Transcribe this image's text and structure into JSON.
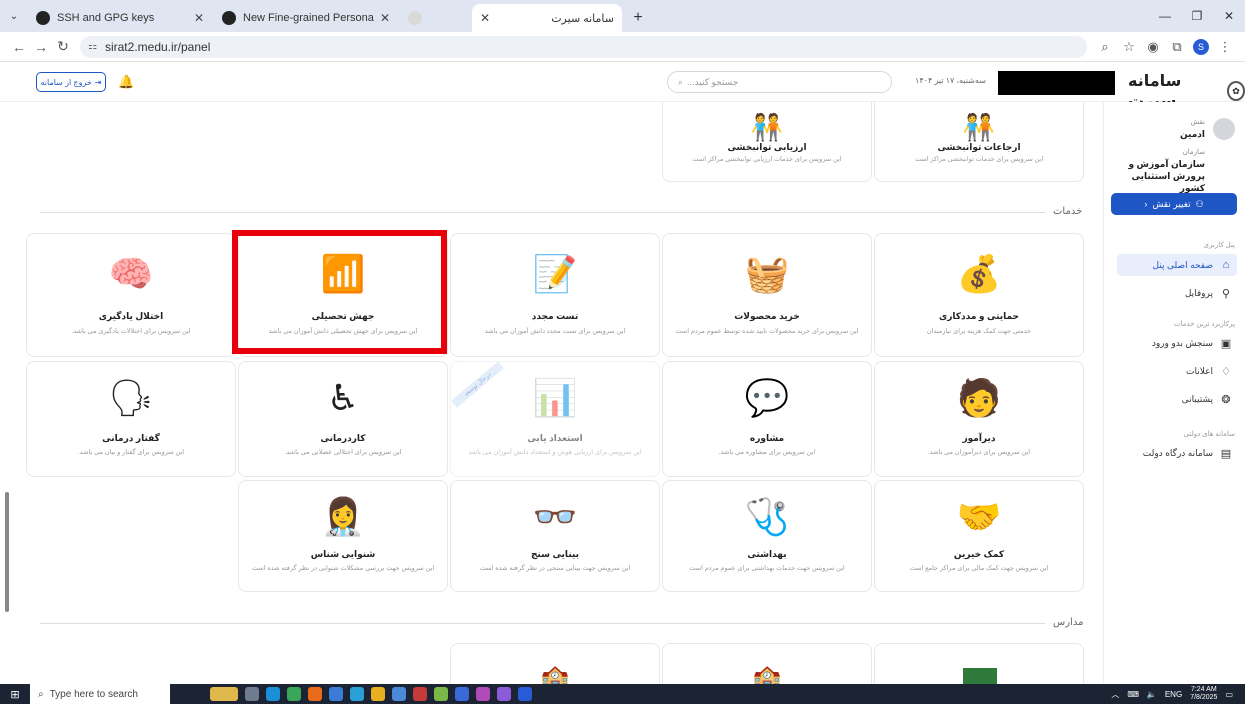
{
  "browser": {
    "tabs": [
      {
        "title": "SSH and GPG keys",
        "active": false
      },
      {
        "title": "New Fine-grained Personal Acc",
        "active": false
      },
      {
        "title": "",
        "active": false
      },
      {
        "title": "سامانه سیرت",
        "active": true
      }
    ],
    "new_tab": "+",
    "url_site_icon": "⚏",
    "url": "sirat2.medu.ir/panel",
    "profile_initial": "S"
  },
  "header": {
    "logout_label": "خروج از سامانه",
    "search_placeholder": "جستجو کنید...",
    "date": "سه‌شنبه، ۱۷ تیر ۱۴۰۴",
    "brand": "سامانه سیرت"
  },
  "sidebar": {
    "role_label": "نقش",
    "role_value": "ادمین",
    "org_label": "سازمان",
    "org_value": "سازمان آموزش و پرورش استثنایی کشور",
    "change_role": "تغییر نقش",
    "panel_section": "پنل کاربری",
    "items_main": [
      {
        "label": "صفحه اصلی پنل",
        "icon": "home-icon",
        "active": true
      },
      {
        "label": "پروفایل",
        "icon": "user-icon",
        "active": false
      }
    ],
    "services_section": "پرکاربرد ترین خدمات",
    "items_services": [
      {
        "label": "سنجش بدو ورود",
        "icon": "clipboard-icon"
      },
      {
        "label": "اعلانات",
        "icon": "bell-icon"
      },
      {
        "label": "پشتیبانی",
        "icon": "support-icon"
      }
    ],
    "gov_section": "سامانه های دولتی",
    "items_gov": [
      {
        "label": "سامانه درگاه دولت",
        "icon": "gov-icon"
      }
    ]
  },
  "top_cards": [
    {
      "title": "ارجاعات توانبخشی",
      "desc": "این سرویس برای خدمات توانبخشی مراکز است"
    },
    {
      "title": "ارزیابی توانبخشی",
      "desc": "این سرویس برای خدمات ارزیابی توانبخشی مراکز است"
    }
  ],
  "services_label": "خدمات",
  "schools_label": "مدارس",
  "services": [
    {
      "title": "حمایتی و مددکاری",
      "desc": "خدمتی جهت کمک هزینه برای نیازمندان",
      "icon": "support-money-icon",
      "glyph": "💰"
    },
    {
      "title": "خرید محصولات",
      "desc": "این سرویس برای خرید محصولات تایید شده توسط عموم مردم است",
      "icon": "shopping-basket-icon",
      "glyph": "🧺"
    },
    {
      "title": "تست مجدد",
      "desc": "این سرویس برای تست مجدد دانش آموزان می باشد",
      "icon": "test-form-icon",
      "glyph": "📝"
    },
    {
      "title": "جهش تحصیلی",
      "desc": "این سرویس برای جهش تحصیلی دانش آموزان می باشد",
      "icon": "stairs-growth-icon",
      "glyph": "📶"
    },
    {
      "title": "اختلال یادگیری",
      "desc": "این سرویس برای اختلالات یادگیری می باشد.",
      "icon": "brain-icon",
      "glyph": "🧠"
    },
    {
      "title": "دیرآموز",
      "desc": "این سرویس برای دیرآموزان می باشد.",
      "icon": "student-icon",
      "glyph": "🧑"
    },
    {
      "title": "مشاوره",
      "desc": "این سرویس برای مشاوره می باشد.",
      "icon": "counseling-icon",
      "glyph": "💬"
    },
    {
      "title": "استعداد یابی",
      "desc": "این سرویس برای ارزیابی هوش و استعداد دانش آموزان می باشد",
      "icon": "gauge-icon",
      "glyph": "📊",
      "ribbon": "درحال توسعه",
      "disabled": true
    },
    {
      "title": "کاردرمانی",
      "desc": "این سرویس برای اختلالی عضلانی می باشد.",
      "icon": "occupational-therapy-icon",
      "glyph": "♿"
    },
    {
      "title": "گفتار درمانی",
      "desc": "این سرویس برای گفتار و بیان می باشد.",
      "icon": "speech-therapy-icon",
      "glyph": "🗣"
    },
    {
      "title": "کمک خیرین",
      "desc": "این سرویس جهت کمک مالی برای مراکز جامع است",
      "icon": "charity-icon",
      "glyph": "🤝"
    },
    {
      "title": "بهداشتی",
      "desc": "این سرویس جهت خدمات بهداشتی برای عموم مردم است",
      "icon": "health-icon",
      "glyph": "🩺"
    },
    {
      "title": "بینایی سنج",
      "desc": "این سرویس جهت بینایی سنجی در نظر گرفته شده است",
      "icon": "eye-test-icon",
      "glyph": "👓"
    },
    {
      "title": "شنوایی شناس",
      "desc": "این سرویس جهت بررسی مشکلات شنوایی در نظر گرفته شده است",
      "icon": "audiologist-icon",
      "glyph": "👩‍⚕️"
    }
  ],
  "taskbar": {
    "search_placeholder": "Type here to search",
    "lang": "ENG",
    "time": "7:24 AM",
    "date": "7/8/2025"
  }
}
